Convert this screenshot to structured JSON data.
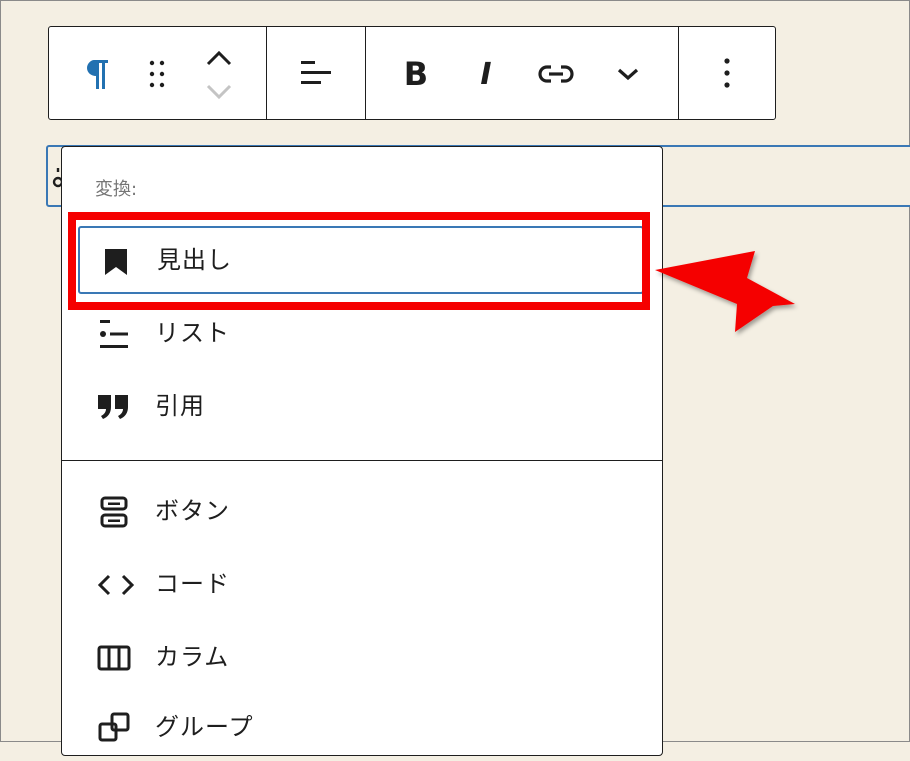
{
  "menu": {
    "section_label": "変換:",
    "items": [
      {
        "label": "見出し",
        "icon": "bookmark-icon"
      },
      {
        "label": "リスト",
        "icon": "list-icon"
      },
      {
        "label": "引用",
        "icon": "quote-icon"
      },
      {
        "label": "ボタン",
        "icon": "buttons-icon"
      },
      {
        "label": "コード",
        "icon": "code-icon"
      },
      {
        "label": "カラム",
        "icon": "columns-icon"
      },
      {
        "label": "グループ",
        "icon": "group-icon"
      }
    ]
  },
  "toolbar": {
    "bold_label": "B",
    "italic_label": "I"
  },
  "colors": {
    "accent": "#3a78b5",
    "paragraph_icon": "#2271b1",
    "highlight": "#f50000",
    "background": "#f4efe3"
  }
}
